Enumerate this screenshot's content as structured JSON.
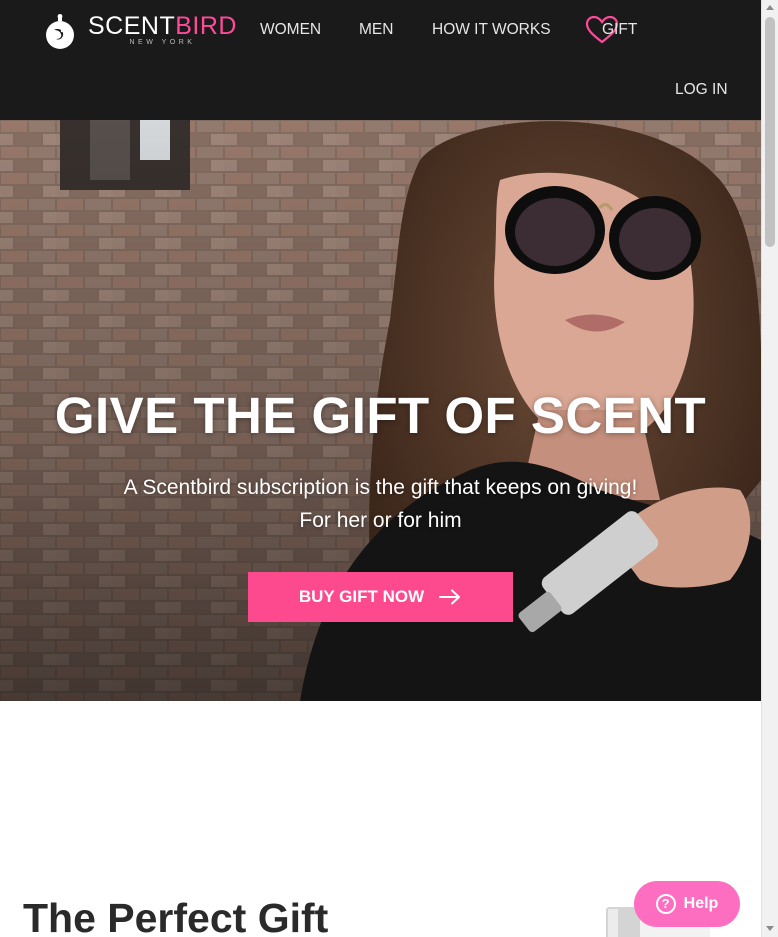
{
  "header": {
    "logo": {
      "word_part1": "SCENT",
      "word_part2": "BIRD",
      "tagline": "NEW YORK"
    },
    "nav": {
      "women": "WOMEN",
      "men": "MEN",
      "how_it_works": "HOW IT WORKS",
      "gift": "GIFT",
      "login": "LOG IN"
    }
  },
  "hero": {
    "title": "GIVE THE GIFT OF SCENT",
    "subtitle_line1": "A Scentbird subscription is the gift that keeps on giving!",
    "subtitle_line2": "For her or for him",
    "cta_label": "BUY GIFT NOW"
  },
  "section": {
    "title": "The Perfect Gift"
  },
  "help": {
    "label": "Help",
    "icon_glyph": "?"
  },
  "colors": {
    "brand_pink": "#fd4a8e",
    "logo_pink": "#ff4a9a",
    "help_pink": "#fd6ec0",
    "header_bg": "#1a1a1a"
  },
  "icons": {
    "logo": "scentbird-bird-icon",
    "gift": "heart-icon",
    "cta": "arrow-right-icon",
    "help": "question-circle-icon"
  }
}
